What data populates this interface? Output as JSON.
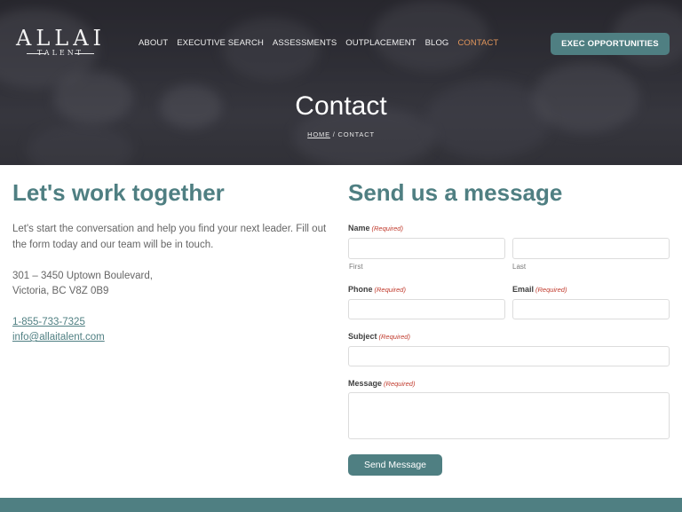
{
  "header": {
    "logo_main": "ALLAI",
    "logo_sub": "TALENT",
    "nav": [
      "ABOUT",
      "EXECUTIVE SEARCH",
      "ASSESSMENTS",
      "OUTPLACEMENT",
      "BLOG",
      "CONTACT"
    ],
    "active_nav": "CONTACT",
    "cta_label": "EXEC OPPORTUNITIES"
  },
  "hero": {
    "title": "Contact",
    "breadcrumb_home": "HOME",
    "breadcrumb_sep": " / ",
    "breadcrumb_current": "CONTACT"
  },
  "left": {
    "heading": "Let's work together",
    "intro": "Let's start the conversation and help you find your next leader. Fill out the form today and our team will be in touch.",
    "address_line1": "301 – 3450 Uptown Boulevard,",
    "address_line2": "Victoria, BC V8Z 0B9",
    "phone": "1-855-733-7325",
    "email": "info@allaitalent.com"
  },
  "form": {
    "heading": "Send us a message",
    "required_text": "(Required)",
    "name_label": "Name",
    "first_sublabel": "First",
    "last_sublabel": "Last",
    "phone_label": "Phone",
    "email_label": "Email",
    "subject_label": "Subject",
    "message_label": "Message",
    "submit_label": "Send Message",
    "values": {
      "first": "",
      "last": "",
      "phone": "",
      "email": "",
      "subject": "",
      "message": ""
    }
  },
  "colors": {
    "accent": "#4f7f82",
    "nav_active": "#e0955a",
    "required": "#c0392b"
  }
}
